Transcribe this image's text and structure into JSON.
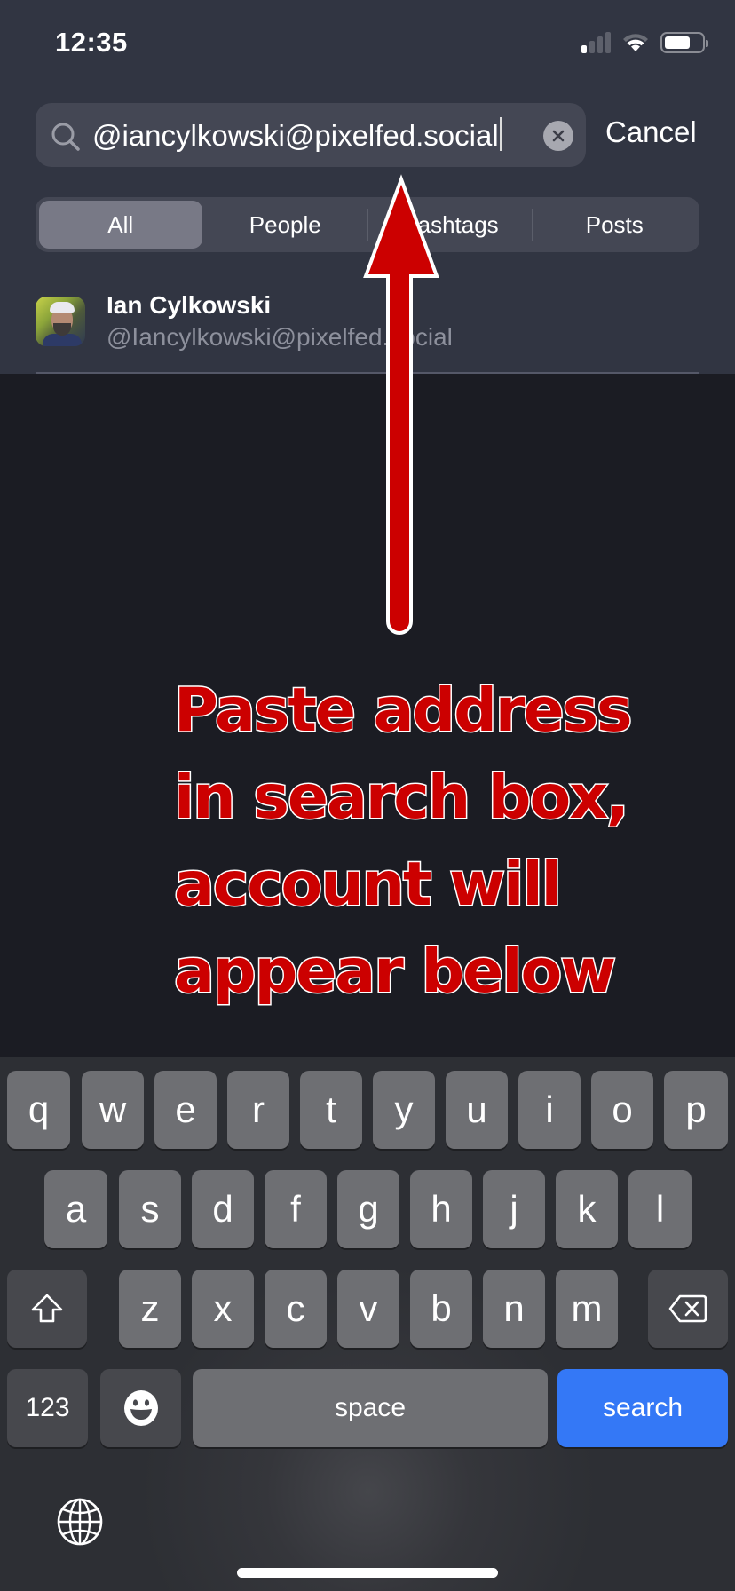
{
  "status_bar": {
    "time": "12:35",
    "signal_bars_active": 1,
    "signal_bars_total": 4,
    "battery_level_percent": 70,
    "icons": [
      "signal-icon",
      "wifi-icon",
      "battery-icon"
    ]
  },
  "search": {
    "value": "@iancylkowski@pixelfed.social",
    "clear_icon": "clear-icon",
    "search_icon": "search-icon",
    "cancel_label": "Cancel"
  },
  "tabs": [
    {
      "label": "All",
      "active": true
    },
    {
      "label": "People",
      "active": false
    },
    {
      "label": "Hashtags",
      "active": false
    },
    {
      "label": "Posts",
      "active": false
    }
  ],
  "results": [
    {
      "name": "Ian Cylkowski",
      "handle": "@Iancylkowski@pixelfed.social"
    }
  ],
  "annotation": {
    "lines": [
      "Paste address",
      "in search box,",
      "account will",
      "appear below"
    ],
    "color": "#cc0000",
    "outline_color": "#ffffff"
  },
  "keyboard": {
    "row1": [
      "q",
      "w",
      "e",
      "r",
      "t",
      "y",
      "u",
      "i",
      "o",
      "p"
    ],
    "row2": [
      "a",
      "s",
      "d",
      "f",
      "g",
      "h",
      "j",
      "k",
      "l"
    ],
    "row3": [
      "z",
      "x",
      "c",
      "v",
      "b",
      "n",
      "m"
    ],
    "numbers_label": "123",
    "space_label": "space",
    "return_label": "search",
    "return_color": "#3478f6",
    "shift_icon": "shift-icon",
    "delete_icon": "delete-icon",
    "emoji_icon": "emoji-icon",
    "globe_icon": "globe-icon"
  }
}
